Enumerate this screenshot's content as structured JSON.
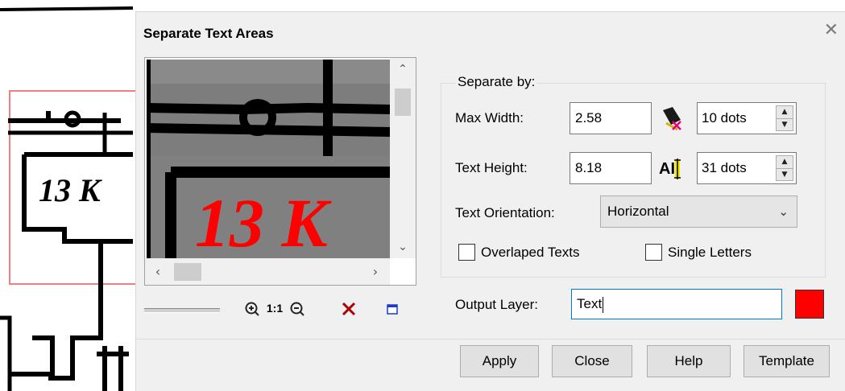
{
  "dialog": {
    "title": "Separate Text Areas",
    "close_icon": "close-icon"
  },
  "preview": {
    "label_text": "13 K"
  },
  "zoom_tools": {
    "zoom_in_icon": "zoom-in-icon",
    "actual_size_label": "1:1",
    "zoom_out_icon": "zoom-out-icon",
    "clear_icon": "delete-icon",
    "window_icon": "window-icon"
  },
  "separate": {
    "legend": "Separate by:",
    "max_width_label": "Max Width:",
    "max_width_value": "2.58",
    "max_width_icon": "eraser-icon",
    "max_width_dots": "10 dots",
    "text_height_label": "Text Height:",
    "text_height_value": "8.18",
    "text_height_icon": "text-height-icon",
    "text_height_dots": "31 dots",
    "orientation_label": "Text Orientation:",
    "orientation_value": "Horizontal",
    "overlapped_label": "Overlaped Texts",
    "single_letters_label": "Single Letters"
  },
  "output": {
    "label": "Output Layer:",
    "value": "Text",
    "color": "#ff0000"
  },
  "buttons": {
    "apply": "Apply",
    "close": "Close",
    "help": "Help",
    "template": "Template"
  },
  "background_drawing": {
    "text": "13 K"
  }
}
